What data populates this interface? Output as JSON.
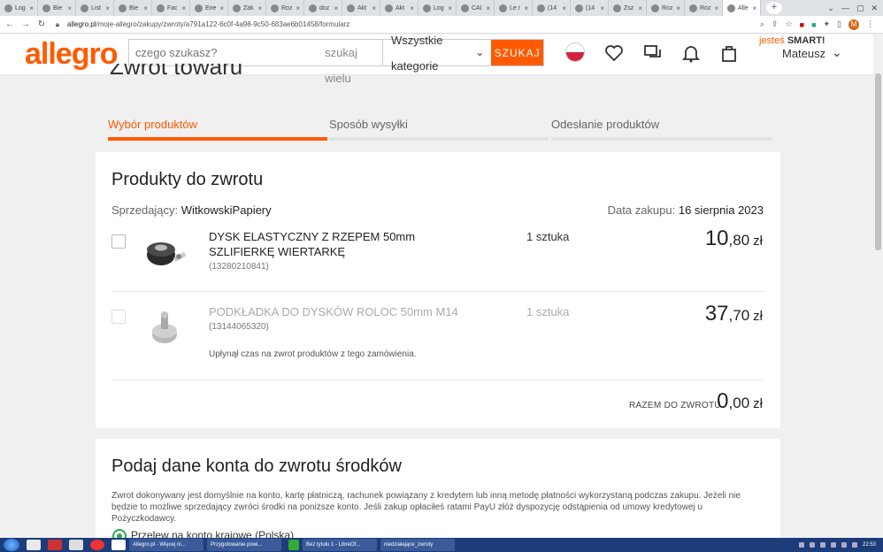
{
  "browser": {
    "tabs": [
      "Log",
      "Bie",
      "List",
      "Bie",
      "Fac",
      "Ene",
      "Zak",
      "Roz",
      "doz",
      "Akt",
      "Akt",
      "Log",
      "CAI",
      "Le r",
      "(14",
      "(14",
      "Zsz",
      "Roz",
      "Roz",
      "Alle"
    ],
    "url_base": "allegro.pl",
    "url_path": "/moje-allegro/zakupy/zwroty/a791a122-6c0f-4a98-9c50-683ae6b01458/formularz",
    "profile_initial": "M"
  },
  "header": {
    "logo": "allegro",
    "search_placeholder": "czego szukasz?",
    "search_mode": "szukaj wielu",
    "category": "Wszystkie kategorie",
    "search_button": "SZUKAJ",
    "smart_prefix": "jesteś",
    "smart_label": "SMART!",
    "user_name": "Mateusz"
  },
  "page": {
    "title_fragment": "Zwrot towaru"
  },
  "steps": [
    {
      "label": "Wybór produktów",
      "active": true
    },
    {
      "label": "Sposób wysyłki",
      "active": false
    },
    {
      "label": "Odesłanie produktów",
      "active": false
    }
  ],
  "products_card": {
    "title": "Produkty do zwrotu",
    "seller_label": "Sprzedający:",
    "seller_name": "WitkowskiPapiery",
    "date_label": "Data zakupu:",
    "date_value": "16 sierpnia 2023",
    "items": [
      {
        "name": "DYSK ELASTYCZNY Z RZEPEM 50mm SZLIFIERKĘ WIERTARKĘ",
        "id": "(13280210841)",
        "qty": "1 sztuka",
        "price_int": "10",
        "price_dec": ",80",
        "currency": "zł"
      },
      {
        "name": "PODKŁADKA DO DYSKÓW ROLOC 50mm M14",
        "id": "(13144065320)",
        "qty": "1 sztuka",
        "price_int": "37",
        "price_dec": ",70",
        "currency": "zł"
      }
    ],
    "expired_note": "Upłynął czas na zwrot produktów z tego zamówienia.",
    "total_label": "RAZEM DO ZWROTU",
    "total_int": "0",
    "total_dec": ",00",
    "total_currency": "zł"
  },
  "refund_card": {
    "title": "Podaj dane konta do zwrotu środków",
    "note": "Zwrot dokonywany jest domyślnie na konto, kartę płatniczą, rachunek powiązany z kredytem lub inną metodę płatności wykorzystaną podczas zakupu. Jeżeli nie będzie to możliwe sprzedający zwróci środki na poniższe konto. Jeśli zakup opłaciłeś ratami PayU złóż dyspozycję odstąpienia od umowy kredytowej u Pożyczkodawcy.",
    "option_label": "Przelew na konto krajowe (Polska)"
  },
  "taskbar": {
    "tasks": [
      "Allegro.pl - Więcej ni...",
      "Przygotowanie powi...",
      "Bez tytułu 1 - LibreOf...",
      "niedziałające_zwroty"
    ],
    "clock": "22:53"
  },
  "colors": {
    "brand": "#ff5a00",
    "radio": "#2da84f"
  }
}
